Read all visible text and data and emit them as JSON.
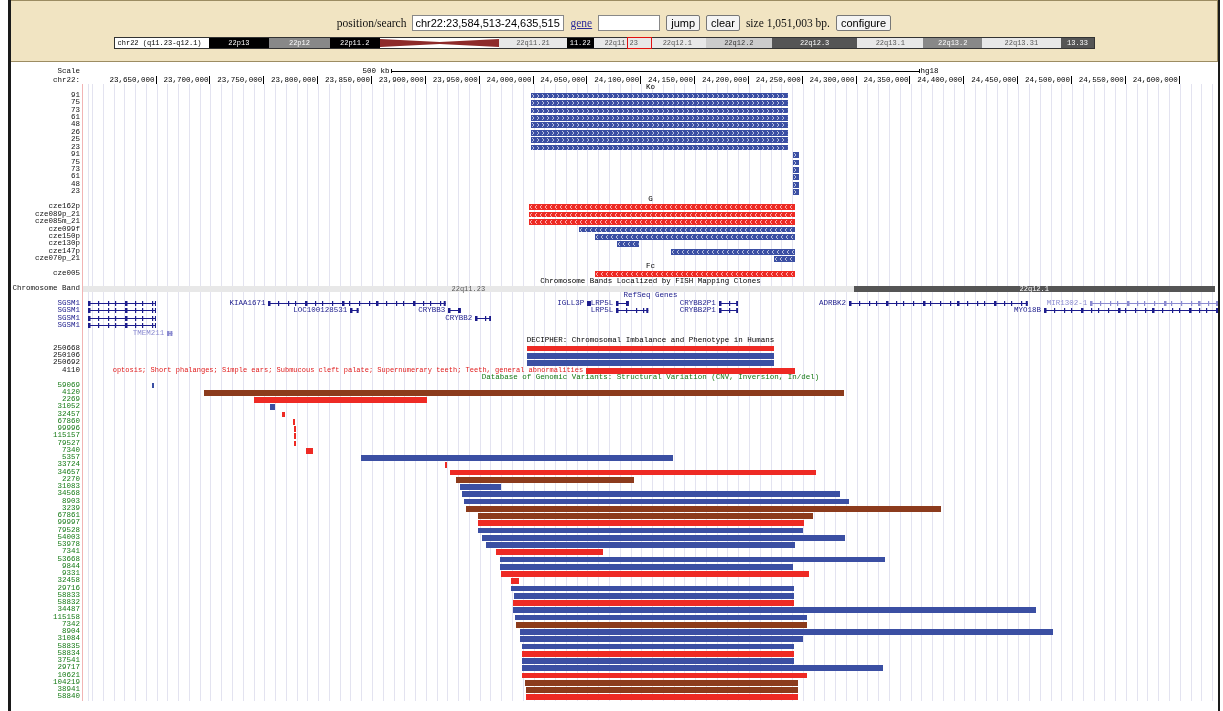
{
  "header": {
    "position_label": "position/search",
    "position_value": "chr22:23,584,513-24,635,515",
    "gene_link": "gene",
    "jump": "jump",
    "clear": "clear",
    "size_text": "size 1,051,003 bp.",
    "configure": "configure"
  },
  "ideogram": {
    "label": "chr22 (q11.23-q12.1)",
    "bands": [
      {
        "label": "22p13",
        "kind": "gpos100"
      },
      {
        "label": "22p12",
        "kind": "gpos50"
      },
      {
        "label": "22p11.2",
        "kind": "gpos100"
      },
      {
        "kind": "acen"
      },
      {
        "label": "22q11.21",
        "kind": "gneg"
      },
      {
        "label": "11.22",
        "kind": "gpos100"
      },
      {
        "label": "22q11.23",
        "kind": "gneg"
      },
      {
        "label": "22q12.1",
        "kind": "gneg"
      },
      {
        "label": "22q12.2",
        "kind": "gpos25"
      },
      {
        "label": "22q12.3",
        "kind": "gpos75"
      },
      {
        "label": "22q13.1",
        "kind": "gneg"
      },
      {
        "label": "22q13.2",
        "kind": "gpos50"
      },
      {
        "label": "22q13.31",
        "kind": "gneg"
      },
      {
        "label": "13.33",
        "kind": "gpos75"
      }
    ]
  },
  "tracks": [
    {
      "kind": "ruler",
      "scale_label": "Scale",
      "scale_bar": "500 kb",
      "assembly": "hg18",
      "chrom_label": "chr22:",
      "ticks": [
        "23,650,000",
        "23,700,000",
        "23,750,000",
        "23,800,000",
        "23,850,000",
        "23,900,000",
        "23,950,000",
        "24,000,000",
        "24,050,000",
        "24,100,000",
        "24,150,000",
        "24,200,000",
        "24,250,000",
        "24,300,000",
        "24,350,000",
        "24,400,000",
        "24,450,000",
        "24,500,000",
        "24,550,000",
        "24,600,000"
      ]
    },
    {
      "kind": "custom",
      "title": "Ko",
      "items": [
        {
          "label": "91",
          "color": "#3b4fa3",
          "kind": "forward"
        },
        {
          "label": "75",
          "color": "#3b4fa3",
          "kind": "forward"
        },
        {
          "label": "73",
          "color": "#3b4fa3",
          "kind": "forward"
        },
        {
          "label": "61",
          "color": "#3b4fa3",
          "kind": "forward"
        },
        {
          "label": "48",
          "color": "#3b4fa3",
          "kind": "forward"
        },
        {
          "label": "26",
          "color": "#3b4fa3",
          "kind": "forward"
        },
        {
          "label": "25",
          "color": "#3b4fa3",
          "kind": "forward"
        },
        {
          "label": "23",
          "color": "#3b4fa3",
          "kind": "forward"
        },
        {
          "label": "91",
          "color": "#3b4fa3",
          "kind": "forward"
        },
        {
          "label": "75",
          "color": "#3b4fa3",
          "kind": "forward"
        },
        {
          "label": "73",
          "color": "#3b4fa3",
          "kind": "forward"
        },
        {
          "label": "61",
          "color": "#3b4fa3",
          "kind": "forward"
        },
        {
          "label": "48",
          "color": "#3b4fa3",
          "kind": "forward"
        },
        {
          "label": "23",
          "color": "#3b4fa3",
          "kind": "forward"
        }
      ]
    },
    {
      "kind": "custom",
      "title": "G",
      "items": [
        {
          "label": "cze162p",
          "color": "#ee2a24",
          "kind": "reverse"
        },
        {
          "label": "cze089p_21",
          "color": "#ee2a24",
          "kind": "reverse"
        },
        {
          "label": "cze085m_21",
          "color": "#ee2a24",
          "kind": "reverse"
        },
        {
          "label": "cze099f",
          "color": "#3b4fa3",
          "kind": "reverse"
        },
        {
          "label": "cze150p",
          "color": "#3b4fa3",
          "kind": "reverse"
        },
        {
          "label": "cze130p",
          "color": "#3b4fa3",
          "kind": "reverse"
        },
        {
          "label": "cze147p",
          "color": "#3b4fa3",
          "kind": "reverse"
        },
        {
          "label": "cze070p_21",
          "color": "#3b4fa3",
          "kind": "reverse"
        }
      ]
    },
    {
      "kind": "custom",
      "title": "Fc",
      "items": [
        {
          "label": "cze005",
          "color": "#ee2a24",
          "kind": "reverse"
        }
      ]
    },
    {
      "kind": "bands",
      "title": "Chromosome Bands Localized by FISH Mapping Clones",
      "label": "Chromosome Band",
      "segments": [
        {
          "label": "22q11.23",
          "kind": "gneg"
        },
        {
          "label": "22q12.1",
          "kind": "gpos75"
        }
      ]
    },
    {
      "kind": "genes",
      "title": "RefSeq Genes",
      "rows": [
        {
          "label": "SGSM1",
          "genes": [
            {
              "kind": "coding"
            },
            {
              "label": "KIAA1671",
              "kind": "coding"
            },
            {
              "label": "IGLL3P",
              "kind": "coding"
            },
            {
              "label": "LRP5L",
              "kind": "coding"
            },
            {
              "label": "CRYBB2P1",
              "kind": "coding"
            },
            {
              "label": "ADRBK2",
              "kind": "coding"
            },
            {
              "label": "MIR1302-1",
              "kind": "noncoding"
            }
          ]
        },
        {
          "label": "SGSM1",
          "genes": [
            {
              "kind": "coding"
            },
            {
              "label": "LOC100128531",
              "kind": "coding"
            },
            {
              "label": "CRYBB3",
              "kind": "coding"
            },
            {
              "label": "LRP5L",
              "kind": "coding"
            },
            {
              "label": "CRYBB2P1",
              "kind": "coding"
            },
            {
              "label": "MYO18B",
              "kind": "coding"
            }
          ]
        },
        {
          "label": "SGSM1",
          "genes": [
            {
              "kind": "coding"
            },
            {
              "label": "CRYBB2",
              "kind": "coding"
            }
          ]
        },
        {
          "label": "SGSM1",
          "genes": [
            {
              "kind": "coding"
            }
          ]
        },
        {
          "genes": [
            {
              "label": "TMEM211",
              "kind": "noncoding"
            }
          ]
        }
      ]
    },
    {
      "kind": "decipher",
      "title": "DECIPHER: Chromosomal Imbalance and Phenotype in Humans",
      "items": [
        {
          "label": "250668",
          "color": "#ee2a24",
          "kind": "plain"
        },
        {
          "label": "250106",
          "color": "#3b4fa3",
          "kind": "plain"
        },
        {
          "label": "250692",
          "color": "#3b4fa3",
          "kind": "plain"
        },
        {
          "label": "4110",
          "color": "#ee2a24",
          "kind": "plain",
          "note": "optosis; Short phalanges; Simple ears; Submucous cleft palate; Supernumerary teeth; Teeth, general abnormalities"
        }
      ]
    },
    {
      "kind": "dgv",
      "title": "Database of Genomic Variants: Structural Variation (CNV, Inversion, In/del)",
      "items": [
        {
          "label": "59069",
          "color": "#3b4fa3",
          "kind": "plain"
        },
        {
          "label": "4120",
          "color": "#8c3b1c",
          "kind": "plain"
        },
        {
          "label": "2269",
          "color": "#ee2a24",
          "kind": "plain"
        },
        {
          "label": "31052",
          "color": "#3b4fa3",
          "kind": "plain"
        },
        {
          "label": "32457",
          "color": "#ee2a24",
          "kind": "plain"
        },
        {
          "label": "67860",
          "color": "#ee2a24",
          "kind": "plain"
        },
        {
          "label": "99996",
          "color": "#ee2a24",
          "kind": "plain"
        },
        {
          "label": "115157",
          "color": "#ee2a24",
          "kind": "plain"
        },
        {
          "label": "79527",
          "color": "#ee2a24",
          "kind": "plain"
        },
        {
          "label": "7340",
          "color": "#ee2a24",
          "kind": "plain"
        },
        {
          "label": "5357",
          "color": "#3b4fa3",
          "kind": "plain"
        },
        {
          "label": "33724",
          "color": "#ee2a24",
          "kind": "plain"
        },
        {
          "label": "34657",
          "color": "#ee2a24",
          "kind": "plain"
        },
        {
          "label": "2270",
          "color": "#8c3b1c",
          "kind": "plain"
        },
        {
          "label": "31083",
          "color": "#3b4fa3",
          "kind": "plain"
        },
        {
          "label": "34568",
          "color": "#3b4fa3",
          "kind": "plain"
        },
        {
          "label": "8903",
          "color": "#3b4fa3",
          "kind": "plain"
        },
        {
          "label": "3239",
          "color": "#8c3b1c",
          "kind": "plain"
        },
        {
          "label": "67861",
          "color": "#8c3b1c",
          "kind": "plain"
        },
        {
          "label": "99997",
          "color": "#ee2a24",
          "kind": "plain"
        },
        {
          "label": "79528",
          "color": "#3b4fa3",
          "kind": "plain"
        },
        {
          "label": "54003",
          "color": "#3b4fa3",
          "kind": "plain"
        },
        {
          "label": "53978",
          "color": "#3b4fa3",
          "kind": "plain"
        },
        {
          "label": "7341",
          "color": "#ee2a24",
          "kind": "plain"
        },
        {
          "label": "53668",
          "color": "#3b4fa3",
          "kind": "plain"
        },
        {
          "label": "9844",
          "color": "#3b4fa3",
          "kind": "plain"
        },
        {
          "label": "9331",
          "color": "#ee2a24",
          "kind": "plain"
        },
        {
          "label": "32458",
          "color": "#ee2a24",
          "kind": "plain"
        },
        {
          "label": "29716",
          "color": "#3b4fa3",
          "kind": "plain"
        },
        {
          "label": "58833",
          "color": "#3b4fa3",
          "kind": "plain"
        },
        {
          "label": "58832",
          "color": "#ee2a24",
          "kind": "plain"
        },
        {
          "label": "34487",
          "color": "#3b4fa3",
          "kind": "plain"
        },
        {
          "label": "115158",
          "color": "#3b4fa3",
          "kind": "plain"
        },
        {
          "label": "7342",
          "color": "#8c3b1c",
          "kind": "plain"
        },
        {
          "label": "8904",
          "color": "#3b4fa3",
          "kind": "plain"
        },
        {
          "label": "31084",
          "color": "#3b4fa3",
          "kind": "plain"
        },
        {
          "label": "58835",
          "color": "#3b4fa3",
          "kind": "plain"
        },
        {
          "label": "58834",
          "color": "#ee2a24",
          "kind": "plain"
        },
        {
          "label": "37541",
          "color": "#3b4fa3",
          "kind": "plain"
        },
        {
          "label": "29717",
          "color": "#3b4fa3",
          "kind": "plain"
        },
        {
          "label": "10621",
          "color": "#ee2a24",
          "kind": "plain"
        },
        {
          "label": "104219",
          "color": "#8c3b1c",
          "kind": "plain"
        },
        {
          "label": "38941",
          "color": "#8c3b1c",
          "kind": "plain"
        },
        {
          "label": "58840",
          "color": "#ee2a24",
          "kind": "plain"
        }
      ]
    }
  ]
}
